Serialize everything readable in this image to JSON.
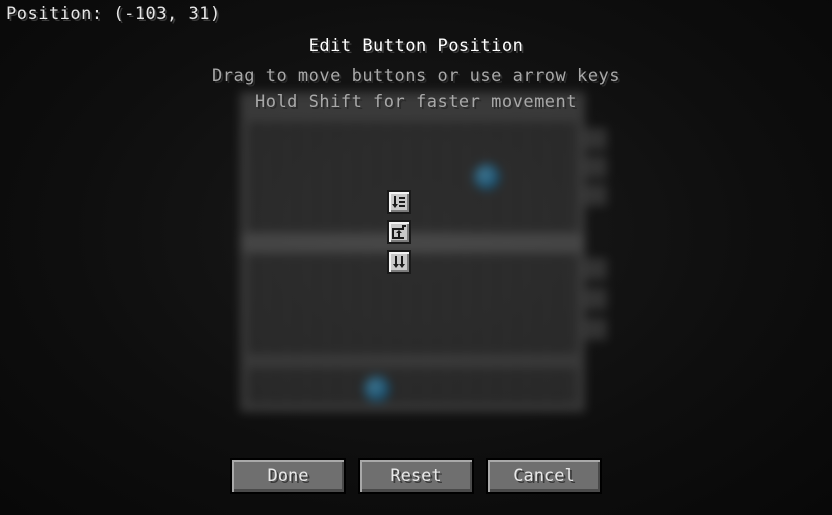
{
  "hud": {
    "position_text": "Position: (-103, 31)"
  },
  "header": {
    "title": "Edit Button Position",
    "instructions_line1": "Drag to move buttons or use arrow keys",
    "instructions_line2": "Hold Shift for faster movement"
  },
  "edit_buttons": [
    {
      "icon": "sort-down-icon"
    },
    {
      "icon": "move-to-container-icon"
    },
    {
      "icon": "double-arrow-down-icon"
    }
  ],
  "buttons": {
    "done_label": "Done",
    "reset_label": "Reset",
    "cancel_label": "Cancel"
  },
  "colors": {
    "button_face": "#6f6f6f",
    "icon_button_face": "#c9c9c9",
    "title_text": "#ffffff",
    "subtitle_text": "#a8a8a8"
  }
}
